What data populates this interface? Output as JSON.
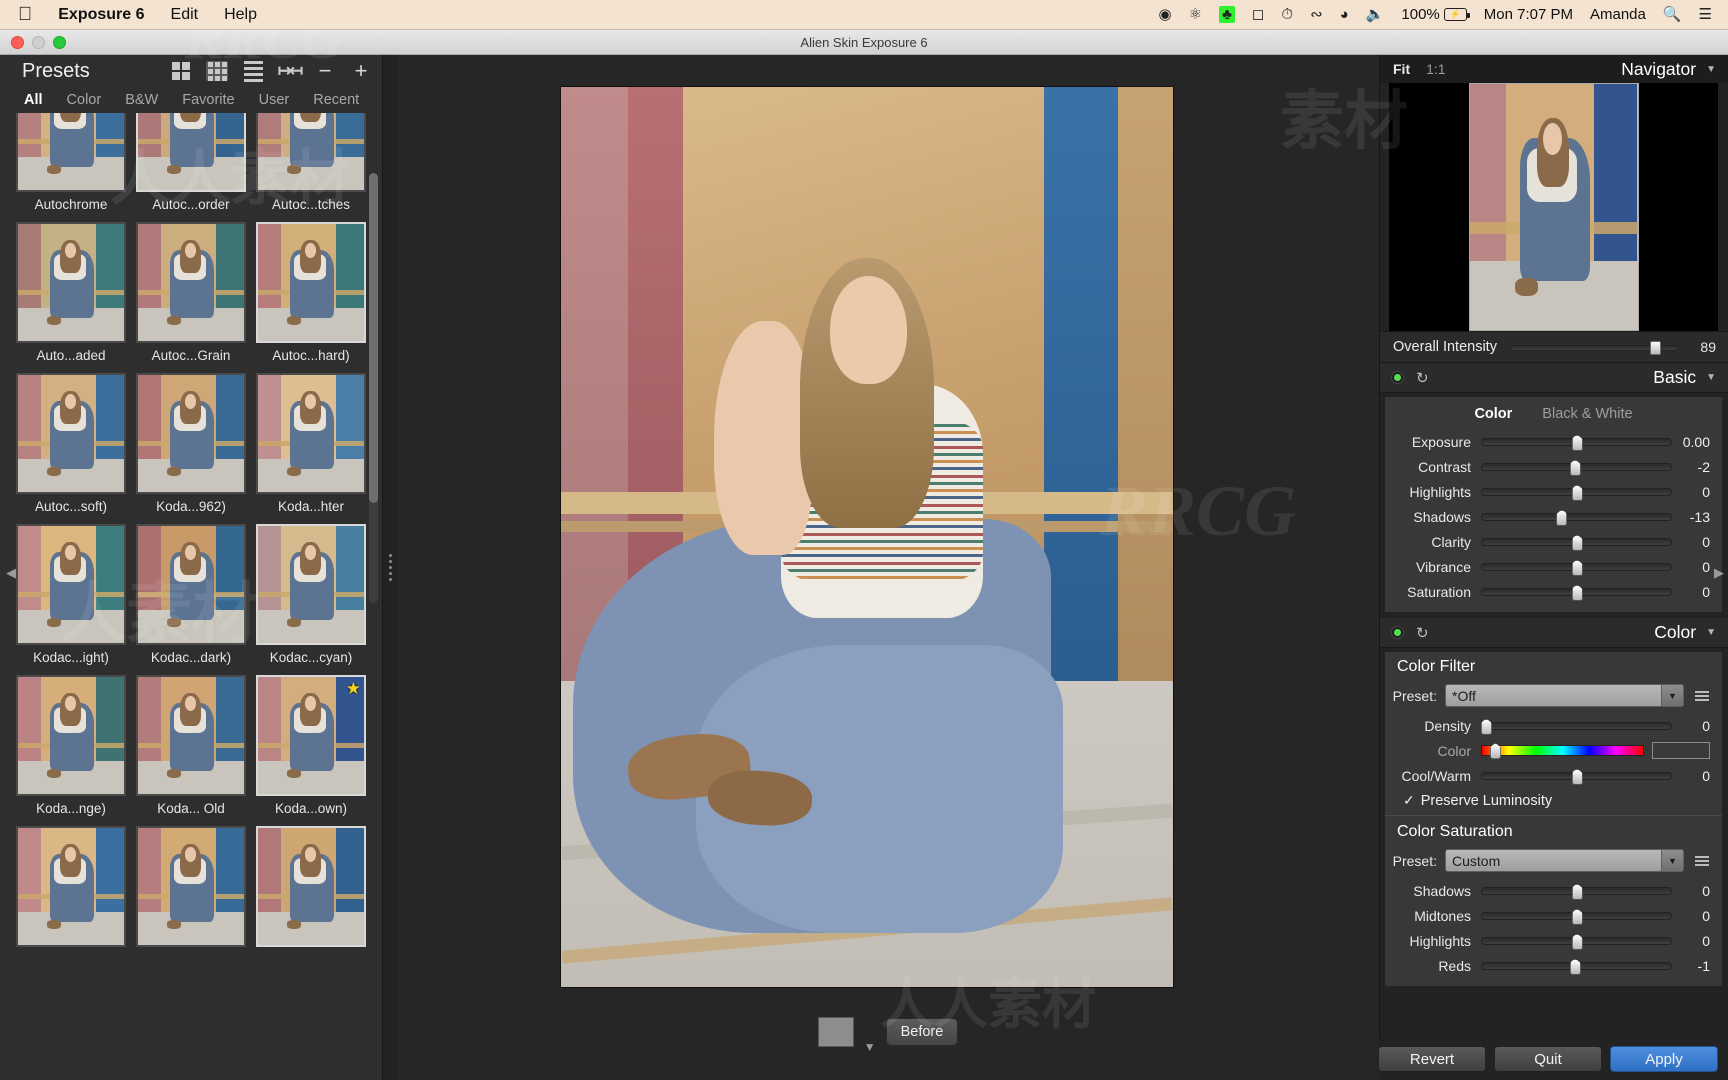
{
  "menubar": {
    "apple_icon": "apple-icon",
    "app_name": "Exposure 6",
    "items": [
      "Edit",
      "Help"
    ],
    "status_icons": [
      "record-icon",
      "creative-cloud-icon",
      "app-green-icon",
      "airplay-icon",
      "time-machine-icon",
      "bluetooth-icon",
      "wifi-icon",
      "volume-icon"
    ],
    "battery_percent": "100%",
    "battery_icon": "battery-charging-icon",
    "datetime": "Mon 7:07 PM",
    "user": "Amanda",
    "search_icon": "search-icon",
    "menu_icon": "control-center-icon"
  },
  "window": {
    "title": "Alien Skin Exposure 6"
  },
  "presets": {
    "title": "Presets",
    "view_icons": [
      "grid-large-icon",
      "grid-small-icon",
      "list-icon",
      "collapse-icon",
      "minus-icon",
      "plus-icon"
    ],
    "tabs": [
      "All",
      "Color",
      "B&W",
      "Favorite",
      "User",
      "Recent"
    ],
    "active_tab": "All",
    "search_icon": "search-icon",
    "items": [
      {
        "label": "Autochrome",
        "selected": false,
        "fav": false,
        "tint": "#cfae86",
        "wallL": "#b58080",
        "wallM": "#d2b184",
        "wallR": "#3c6f9c"
      },
      {
        "label": "Autoc...order",
        "selected": true,
        "fav": false,
        "tint": "#c5a57d",
        "wallL": "#ad7878",
        "wallM": "#c9a97d",
        "wallR": "#35648f"
      },
      {
        "label": "Autoc...tches",
        "selected": false,
        "fav": false,
        "tint": "#c9ab84",
        "wallL": "#b07b7b",
        "wallM": "#cdad82",
        "wallR": "#3a6c98"
      },
      {
        "label": "Auto...aded",
        "selected": false,
        "fav": false,
        "tint": "#b7a98a",
        "wallL": "#a87b76",
        "wallM": "#c4b184",
        "wallR": "#3f7a7a"
      },
      {
        "label": "Autoc...Grain",
        "selected": false,
        "fav": false,
        "tint": "#c4a97f",
        "wallL": "#b07a7a",
        "wallM": "#ccae7e",
        "wallR": "#3f7474"
      },
      {
        "label": "Autoc...hard)",
        "selected": true,
        "fav": false,
        "tint": "#c9a97c",
        "wallL": "#b67b7b",
        "wallM": "#d2ae79",
        "wallR": "#3d7878"
      },
      {
        "label": "Autoc...soft)",
        "selected": false,
        "fav": false,
        "tint": "#cbab82",
        "wallL": "#b98282",
        "wallM": "#d3b083",
        "wallR": "#3c6f9c"
      },
      {
        "label": "Koda...962)",
        "selected": false,
        "fav": false,
        "tint": "#c7a079",
        "wallL": "#b17676",
        "wallM": "#cfa675",
        "wallR": "#3a6b95"
      },
      {
        "label": "Koda...hter",
        "selected": false,
        "fav": false,
        "tint": "#d3b894",
        "wallL": "#c09090",
        "wallM": "#dcbe92",
        "wallR": "#4b7fa8"
      },
      {
        "label": "Kodac...ight)",
        "selected": false,
        "fav": false,
        "tint": "#d4b084",
        "wallL": "#c08b8b",
        "wallM": "#dbb77f",
        "wallR": "#3d7d7d"
      },
      {
        "label": "Kodac...dark)",
        "selected": false,
        "fav": false,
        "tint": "#c09870",
        "wallL": "#ab7070",
        "wallM": "#c89a68",
        "wallR": "#35688f"
      },
      {
        "label": "Kodac...cyan)",
        "selected": true,
        "fav": false,
        "tint": "#cdb38d",
        "wallL": "#b79292",
        "wallM": "#d4bb8d",
        "wallR": "#497f9e"
      },
      {
        "label": "Koda...nge)",
        "selected": false,
        "fav": false,
        "tint": "#cfa87c",
        "wallL": "#bb8383",
        "wallM": "#d6ae79",
        "wallR": "#3f7272"
      },
      {
        "label": "Koda... Old",
        "selected": false,
        "fav": false,
        "tint": "#c8a178",
        "wallL": "#b37c7c",
        "wallM": "#d0a573",
        "wallR": "#3a6b95"
      },
      {
        "label": "Koda...own)",
        "selected": true,
        "fav": true,
        "tint": "#cca77f",
        "wallL": "#b98585",
        "wallM": "#d3ad7d",
        "wallR": "#33558f"
      },
      {
        "label": "",
        "selected": false,
        "fav": false,
        "tint": "#d2b183",
        "wallL": "#c18a8a",
        "wallM": "#dab784",
        "wallR": "#3b6fa0"
      },
      {
        "label": "",
        "selected": false,
        "fav": false,
        "tint": "#c9a478",
        "wallL": "#b57d7d",
        "wallM": "#d2aa74",
        "wallR": "#376a97"
      },
      {
        "label": "",
        "selected": true,
        "fav": false,
        "tint": "#c5a074",
        "wallL": "#b07878",
        "wallM": "#cea671",
        "wallR": "#33618f"
      }
    ]
  },
  "canvas": {
    "swatch_icon": "color-swatch-button",
    "caret_icon": "chevron-down-icon",
    "before_label": "Before"
  },
  "navigator": {
    "fit_label": "Fit",
    "zoom_label": "1:1",
    "title": "Navigator",
    "caret_icon": "chevron-down-icon"
  },
  "overall_intensity": {
    "label": "Overall Intensity",
    "value": "89",
    "pos_pct": 86
  },
  "basic": {
    "led_icon": "power-led-icon",
    "reset_icon": "reset-icon",
    "title": "Basic",
    "caret_icon": "chevron-down-icon",
    "tabs": [
      "Color",
      "Black & White"
    ],
    "active_tab": "Color",
    "sliders": [
      {
        "label": "Exposure",
        "value": "0.00",
        "pos_pct": 50
      },
      {
        "label": "Contrast",
        "value": "-2",
        "pos_pct": 49
      },
      {
        "label": "Highlights",
        "value": "0",
        "pos_pct": 50
      },
      {
        "label": "Shadows",
        "value": "-13",
        "pos_pct": 42
      },
      {
        "label": "Clarity",
        "value": "0",
        "pos_pct": 50
      },
      {
        "label": "Vibrance",
        "value": "0",
        "pos_pct": 50
      },
      {
        "label": "Saturation",
        "value": "0",
        "pos_pct": 50
      }
    ]
  },
  "color_section": {
    "led_icon": "power-led-icon",
    "reset_icon": "reset-icon",
    "title": "Color",
    "caret_icon": "chevron-down-icon",
    "color_filter": {
      "title": "Color Filter",
      "preset_label": "Preset:",
      "preset_value": "*Off",
      "dropdown_icon": "chevron-down-icon",
      "menu_icon": "hamburger-menu-icon",
      "density": {
        "label": "Density",
        "value": "0",
        "pos_pct": 2
      },
      "color": {
        "label": "Color",
        "pos_pct": 8
      },
      "cool_warm": {
        "label": "Cool/Warm",
        "value": "0",
        "pos_pct": 50
      },
      "preserve_luminosity": {
        "label": "Preserve Luminosity",
        "checked": true,
        "check_icon": "checkmark-icon"
      }
    },
    "color_saturation": {
      "title": "Color Saturation",
      "preset_label": "Preset:",
      "preset_value": "Custom",
      "dropdown_icon": "chevron-down-icon",
      "menu_icon": "hamburger-menu-icon",
      "sliders": [
        {
          "label": "Shadows",
          "value": "0",
          "pos_pct": 50
        },
        {
          "label": "Midtones",
          "value": "0",
          "pos_pct": 50
        },
        {
          "label": "Highlights",
          "value": "0",
          "pos_pct": 50
        },
        {
          "label": "Reds",
          "value": "-1",
          "pos_pct": 49
        }
      ]
    }
  },
  "actions": {
    "revert": "Revert",
    "quit": "Quit",
    "apply": "Apply"
  },
  "watermarks": [
    "RRCG",
    "人人素材"
  ]
}
